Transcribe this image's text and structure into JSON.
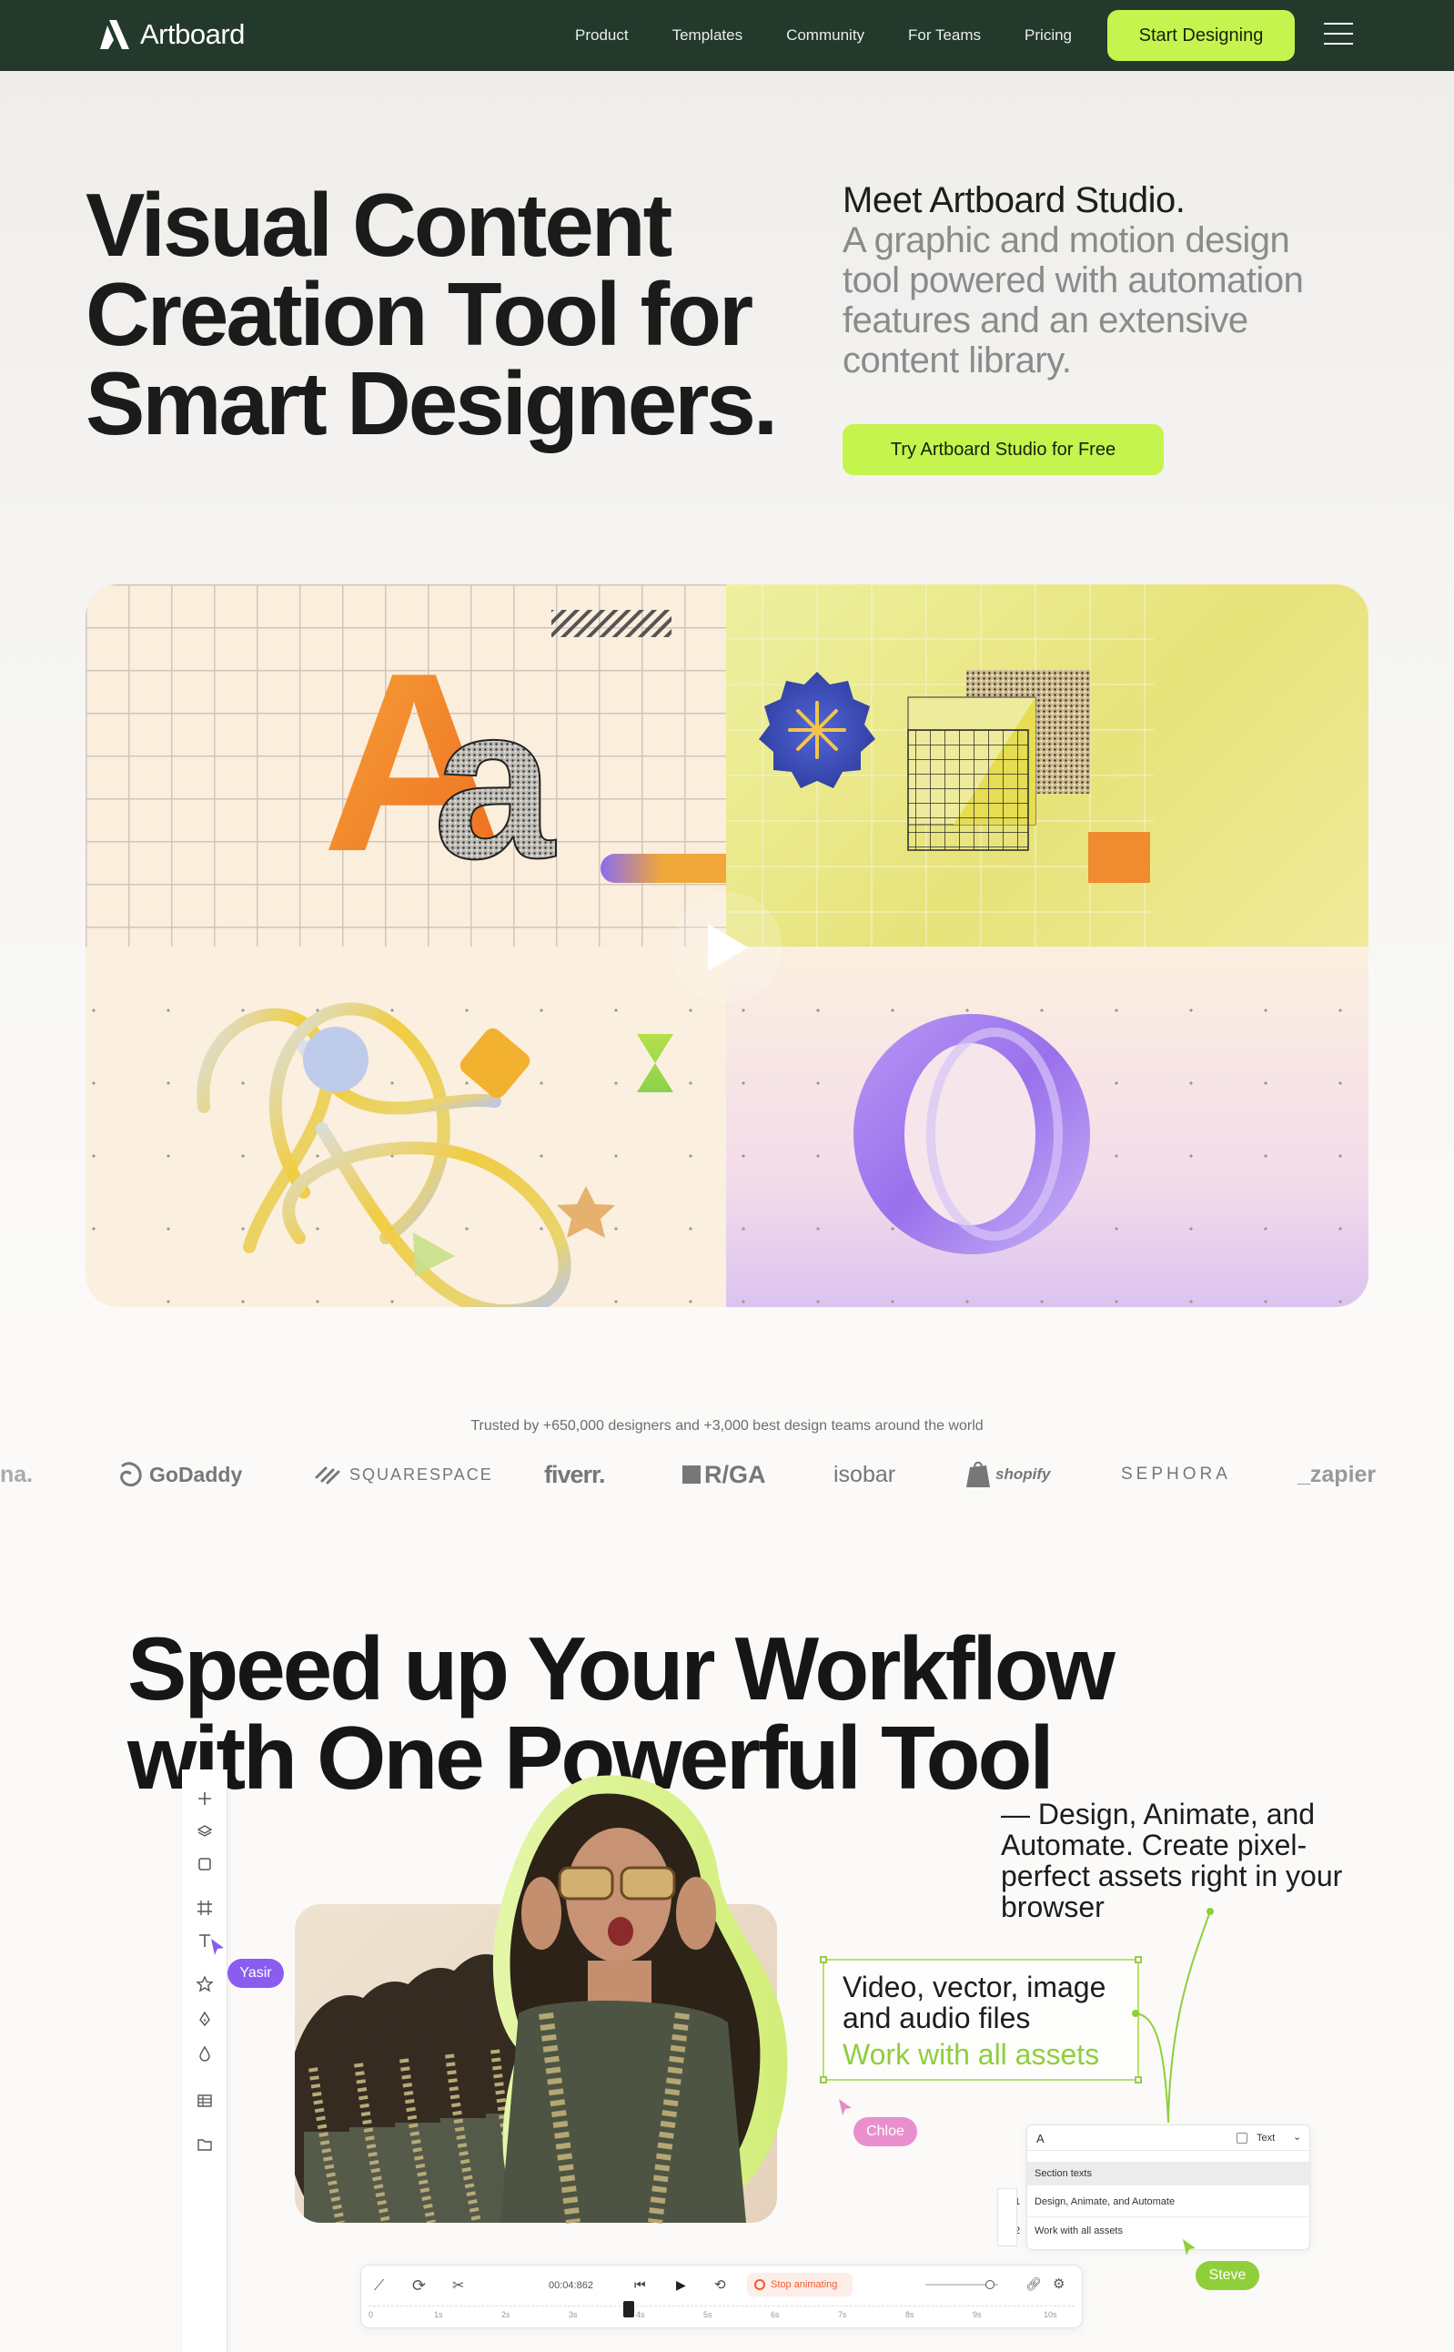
{
  "nav": {
    "logo_text": "Artboard",
    "links": [
      "Product",
      "Templates",
      "Community",
      "For Teams",
      "Pricing"
    ],
    "cta": "Start Designing",
    "colors": {
      "bg": "#23392b",
      "accent": "#c4f44d"
    }
  },
  "hero": {
    "title": "Visual Content Creation Tool for Smart Designers.",
    "sub_head": "Meet Artboard Studio.",
    "sub": "A graphic and motion design tool powered with automation features and an extensive content library.",
    "cta": "Try Artboard Studio for Free"
  },
  "showcase": {
    "glyphs": {
      "upper": "A",
      "lower": "a",
      "ring": "O"
    },
    "icons": [
      "play-icon",
      "asterisk-badge-icon",
      "hourglass-icon",
      "star-icon"
    ]
  },
  "trusted": {
    "text": "Trusted by +650,000 designers and +3,000 best design teams around the world",
    "brands": [
      "na.",
      "GoDaddy",
      "SQUARESPACE",
      "fiverr.",
      "R/GA",
      "isobar",
      "shopify",
      "SEPHORA",
      "_zapier"
    ]
  },
  "workflow": {
    "title_line1": "Speed up Your Workflow",
    "title_line2": "with One Powerful Tool",
    "side_text": "— Design, Animate, and Automate. Create pixel-perfect assets right in your browser",
    "assets_heading": "Video, vector, image and audio files",
    "assets_green": "Work with all assets",
    "collaborators": [
      "Yasir",
      "Chloe",
      "Steve"
    ],
    "panel": {
      "field": "A",
      "type_label": "Text",
      "section": "Section texts",
      "rows": [
        {
          "num": "1",
          "text": "Design, Animate, and Automate"
        },
        {
          "num": "2",
          "text": "Work with all assets"
        }
      ]
    },
    "timeline": {
      "time": "00:04:862",
      "stop_label": "Stop animating",
      "ticks": [
        "0",
        "1s",
        "2s",
        "3s",
        "4s",
        "5s",
        "6s",
        "7s",
        "8s",
        "9s",
        "10s"
      ]
    },
    "tool_icons": [
      "plus-icon",
      "layers-icon",
      "square-icon",
      "frame-icon",
      "text-icon",
      "star-icon",
      "pen-icon",
      "drop-icon",
      "table-icon",
      "folder-icon"
    ]
  }
}
